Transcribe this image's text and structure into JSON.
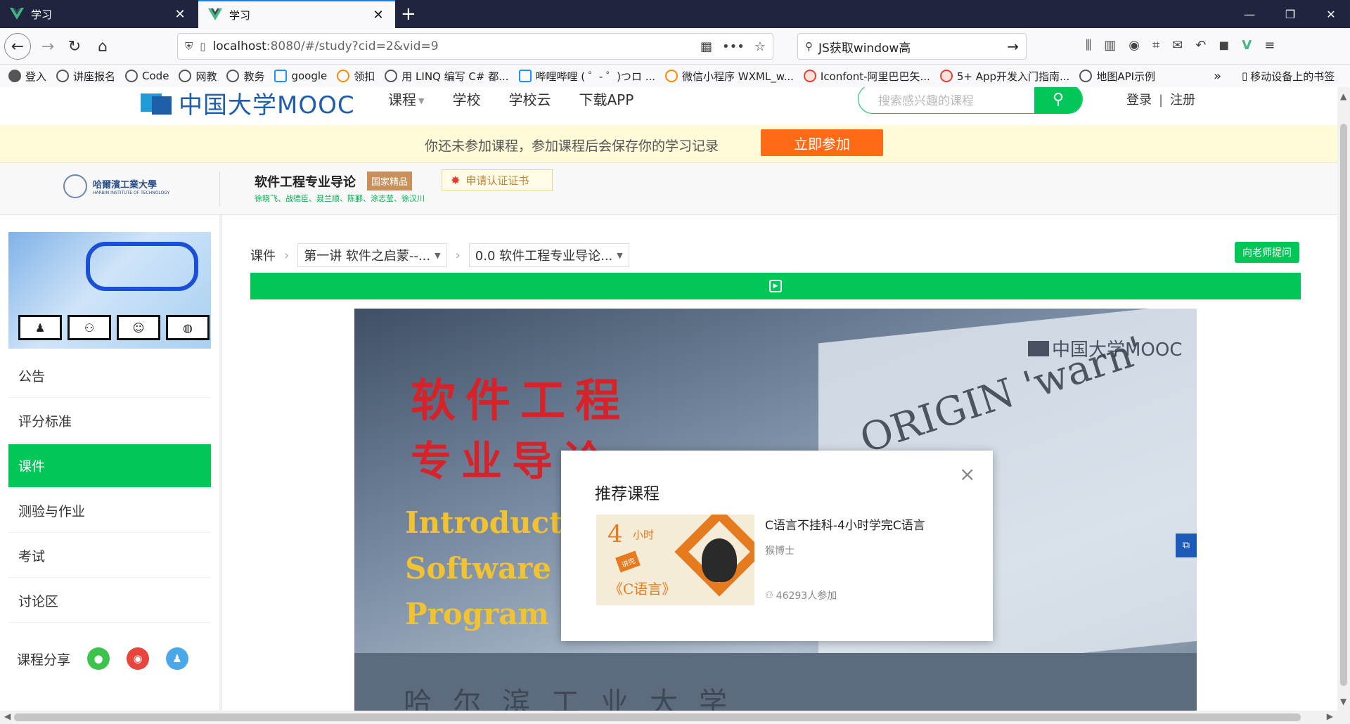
{
  "browser": {
    "tabs": [
      {
        "title": "学习",
        "active": false
      },
      {
        "title": "学习",
        "active": true
      }
    ],
    "url_main": "localhost",
    "url_rest": ":8080/#/study?cid=2&vid=9",
    "search_query": "JS获取window高",
    "bookmarks": [
      {
        "label": "登入",
        "icon": "gear-icon"
      },
      {
        "label": "讲座报名",
        "icon": "globe-icon"
      },
      {
        "label": "Code",
        "icon": "globe-icon"
      },
      {
        "label": "网教",
        "icon": "globe-icon"
      },
      {
        "label": "教务",
        "icon": "globe-icon"
      },
      {
        "label": "google",
        "icon": "google-icon"
      },
      {
        "label": "领扣",
        "icon": "leetcode-icon"
      },
      {
        "label": "用 LINQ 编写 C# 都...",
        "icon": "google-icon"
      },
      {
        "label": "哔哩哔哩 ( ゜- ゜)つロ ...",
        "icon": "bilibili-icon"
      },
      {
        "label": "微信小程序 WXML_w...",
        "icon": "orange-icon"
      },
      {
        "label": "Iconfont-阿里巴巴矢...",
        "icon": "iconfont-icon"
      },
      {
        "label": "5+ App开发入门指南...",
        "icon": "dcloud-icon"
      },
      {
        "label": "地图API示例",
        "icon": "globe-icon"
      }
    ],
    "bookmarks_more": "»",
    "mobile_bookmarks": "移动设备上的书签"
  },
  "site": {
    "logo_text": "中国大学MOOC",
    "nav": [
      {
        "label": "课程",
        "has_caret": true
      },
      {
        "label": "学校",
        "has_caret": false
      },
      {
        "label": "学校云",
        "has_caret": false
      },
      {
        "label": "下载APP",
        "has_caret": false
      }
    ],
    "search_placeholder": "搜索感兴趣的课程",
    "login": "登录",
    "separator": "|",
    "register": "注册"
  },
  "notice": {
    "text": "你还未参加课程，参加课程后会保存你的学习记录",
    "button": "立即参加"
  },
  "course": {
    "school_name": "哈爾濱工業大學",
    "school_sub": "HARBIN INSTITUTE OF TECHNOLOGY",
    "title": "软件工程专业导论",
    "badge": "国家精品",
    "certificate": "申请认证证书",
    "teachers": "徐晓飞、战德臣、聂兰顺、陈鄞、涂志莹、徐汉川"
  },
  "sidebar": {
    "items": [
      {
        "label": "公告",
        "active": false
      },
      {
        "label": "评分标准",
        "active": false
      },
      {
        "label": "课件",
        "active": true
      },
      {
        "label": "测验与作业",
        "active": false
      },
      {
        "label": "考试",
        "active": false
      },
      {
        "label": "讨论区",
        "active": false
      }
    ],
    "share_label": "课程分享"
  },
  "content": {
    "crumb_root": "课件",
    "chapter_select": "第一讲 软件之启蒙--...",
    "lesson_select": "0.0 软件工程专业导论...",
    "ask_button": "向老师提问"
  },
  "video": {
    "title_cn_1": "软件工程",
    "title_cn_2": "专业导论",
    "title_en_1": "Introduction to",
    "title_en_2": "Software Engineering",
    "title_en_3": "Program",
    "watermark": "中国大学MOOC",
    "screen_text": "ORIGIN 'warn' itor",
    "bottom_text": "哈尔滨工业大学"
  },
  "modal": {
    "title": "推荐课程",
    "close": "×",
    "course_title": "C语言不挂科-4小时学完C语言",
    "author": "猴博士",
    "learners": "46293人参加",
    "thumb_big": "4",
    "thumb_small": "小时",
    "thumb_tag": "讲完",
    "thumb_lang": "《C语言》"
  },
  "colors": {
    "accent_green": "#00c758",
    "join_orange": "#ff6a16",
    "tabbar": "#20243f",
    "logo_blue": "#1f5ea8"
  }
}
